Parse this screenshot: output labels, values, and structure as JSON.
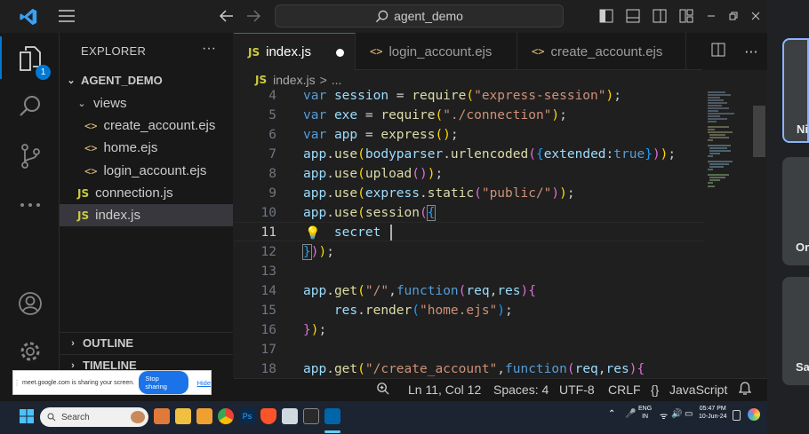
{
  "titlebar": {
    "search_text": "agent_demo"
  },
  "activity_bar": {
    "explorer_badge": "1"
  },
  "sidebar": {
    "title": "EXPLORER",
    "folder": "AGENT_DEMO",
    "subfolder": "views",
    "files_in_views": [
      "create_account.ejs",
      "home.ejs",
      "login_account.ejs"
    ],
    "files": [
      "connection.js",
      "index.js"
    ],
    "outline": "OUTLINE",
    "timeline": "TIMELINE"
  },
  "tabs": [
    {
      "icon": "JS",
      "label": "index.js",
      "modified": true
    },
    {
      "icon": "<>",
      "label": "login_account.ejs"
    },
    {
      "icon": "<>",
      "label": "create_account.ejs"
    }
  ],
  "breadcrumb": {
    "icon": "JS",
    "file": "index.js",
    "sep": ">",
    "rest": "..."
  },
  "editor": {
    "current_line": 11,
    "lines": [
      {
        "n": "4",
        "text": "var session = require(\"express-session\");"
      },
      {
        "n": "5",
        "text": "var exe = require(\"./connection\");"
      },
      {
        "n": "6",
        "text": "var app = express();"
      },
      {
        "n": "7",
        "text": "app.use(bodyparser.urlencoded({extended:true}));"
      },
      {
        "n": "8",
        "text": "app.use(upload());"
      },
      {
        "n": "9",
        "text": "app.use(express.static(\"public/\"));"
      },
      {
        "n": "10",
        "text": "app.use(session({"
      },
      {
        "n": "11",
        "text": "    secret "
      },
      {
        "n": "12",
        "text": "}));"
      },
      {
        "n": "13",
        "text": ""
      },
      {
        "n": "14",
        "text": "app.get(\"/\",function(req,res){"
      },
      {
        "n": "15",
        "text": "    res.render(\"home.ejs\");"
      },
      {
        "n": "16",
        "text": "});"
      },
      {
        "n": "17",
        "text": ""
      },
      {
        "n": "18",
        "text": "app.get(\"/create_account\",function(req,res){"
      }
    ]
  },
  "statusbar": {
    "position": "Ln 11, Col 12",
    "spaces": "Spaces: 4",
    "encoding": "UTF-8",
    "eol": "CRLF",
    "language_icon": "{}",
    "language": "JavaScript"
  },
  "share_banner": {
    "message": "meet.google.com is sharing your screen.",
    "stop_label": "Stop sharing",
    "hide_label": "Hide"
  },
  "taskbar": {
    "search_placeholder": "Search",
    "lang_top": "ENG",
    "lang_bottom": "IN",
    "time": "05:47 PM",
    "date": "10-Jun-24"
  },
  "meet_panel": {
    "cards": [
      "Ni",
      "Or",
      "Sa"
    ]
  }
}
